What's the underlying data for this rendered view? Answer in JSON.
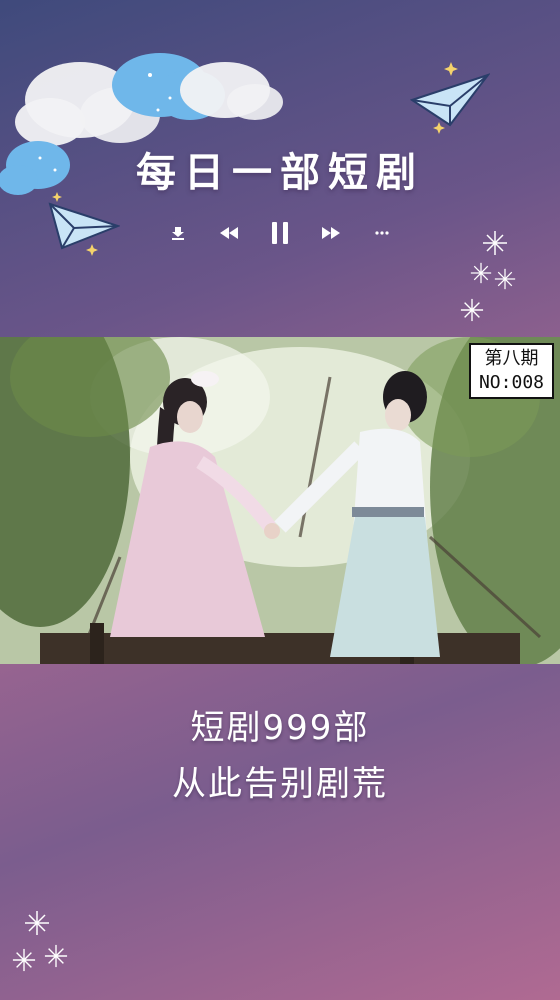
{
  "header": {
    "title": "每日一部短剧",
    "controls": [
      {
        "name": "download-icon"
      },
      {
        "name": "rewind-icon"
      },
      {
        "name": "pause-icon"
      },
      {
        "name": "fast-forward-icon"
      },
      {
        "name": "more-icon"
      }
    ]
  },
  "video": {
    "episode_label": "第八期",
    "episode_number": "NO:008"
  },
  "promo": {
    "line1": "短剧999部",
    "line2": "从此告别剧荒"
  },
  "colors": {
    "accent_blue": "#6fb7ea",
    "cloud_white": "#f2f2f4",
    "background_top": "#3f4a7c",
    "background_bottom": "#b06a92"
  }
}
